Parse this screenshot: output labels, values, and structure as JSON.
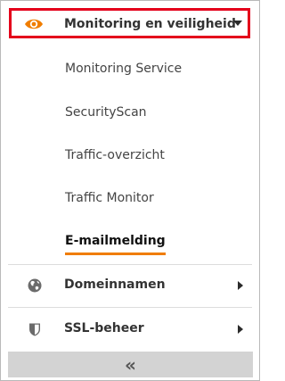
{
  "header": {
    "label": "Monitoring en veiligheid",
    "icon": "eye-icon",
    "accent_color": "#e4001b",
    "icon_color": "#f07d00"
  },
  "submenu": {
    "items": [
      {
        "label": "Monitoring Service"
      },
      {
        "label": "SecurityScan"
      },
      {
        "label": "Traffic-overzicht"
      },
      {
        "label": "Traffic Monitor"
      },
      {
        "label": "E-mailmelding",
        "active": true
      }
    ],
    "active_underline_color": "#f07d00"
  },
  "menu": {
    "domains": {
      "label": "Domeinnamen",
      "icon": "globe-icon"
    },
    "ssl": {
      "label": "SSL-beheer",
      "icon": "shield-icon"
    }
  },
  "collapse": {
    "glyph": "«",
    "icon": "double-chevron-left-icon"
  }
}
